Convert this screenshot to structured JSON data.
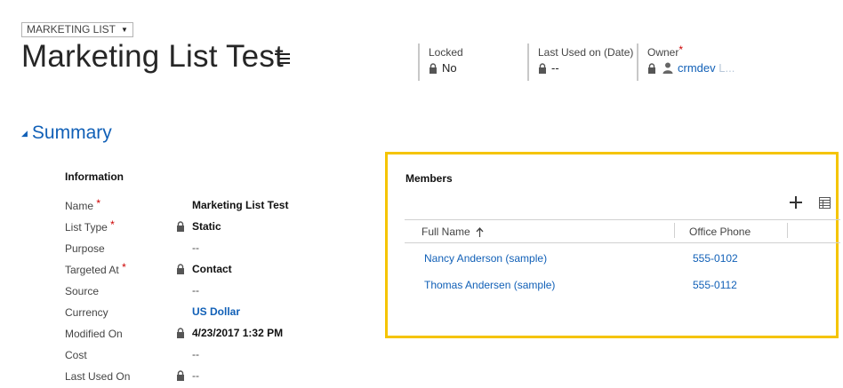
{
  "header": {
    "entity_type": "MARKETING LIST",
    "title": "Marketing List Test",
    "fields": [
      {
        "label": "Locked",
        "value": "No",
        "required": false
      },
      {
        "label": "Last Used on (Date)",
        "value": "--",
        "required": false
      },
      {
        "label": "Owner",
        "value": "crmdev",
        "value_faded": "L...",
        "required": true
      }
    ]
  },
  "summary": {
    "title": "Summary",
    "info_title": "Information",
    "fields": [
      {
        "label": "Name",
        "required": true,
        "locked": false,
        "value": "Marketing List Test",
        "style": "bold"
      },
      {
        "label": "List Type",
        "required": true,
        "locked": true,
        "value": "Static",
        "style": "bold"
      },
      {
        "label": "Purpose",
        "required": false,
        "locked": false,
        "value": "--",
        "style": "dash"
      },
      {
        "label": "Targeted At",
        "required": true,
        "locked": true,
        "value": "Contact",
        "style": "bold"
      },
      {
        "label": "Source",
        "required": false,
        "locked": false,
        "value": "--",
        "style": "dash"
      },
      {
        "label": "Currency",
        "required": false,
        "locked": false,
        "value": "US Dollar",
        "style": "link"
      },
      {
        "label": "Modified On",
        "required": false,
        "locked": true,
        "value": "4/23/2017   1:32 PM",
        "style": "bold"
      },
      {
        "label": "Cost",
        "required": false,
        "locked": false,
        "value": "--",
        "style": "dash"
      },
      {
        "label": "Last Used On",
        "required": false,
        "locked": true,
        "value": "--",
        "style": "dash"
      }
    ]
  },
  "members": {
    "title": "Members",
    "columns": [
      "Full Name",
      "Office Phone"
    ],
    "sort_icon": "arrow-up-icon",
    "rows": [
      {
        "full_name": "Nancy Anderson (sample)",
        "office_phone": "555-0102"
      },
      {
        "full_name": "Thomas Andersen (sample)",
        "office_phone": "555-0112"
      }
    ]
  },
  "colors": {
    "accent_blue": "#1160b7",
    "highlight_border": "#f5c400",
    "required_red": "#cc0000"
  }
}
